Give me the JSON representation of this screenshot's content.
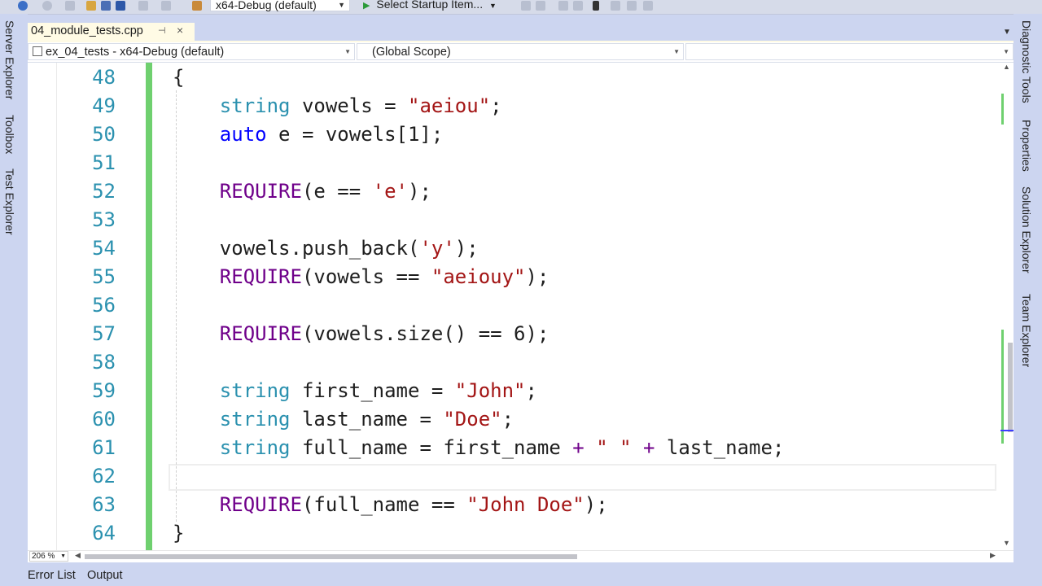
{
  "toolbar": {
    "config_dropdown": "x64-Debug (default)",
    "startup_button": "Select Startup Item..."
  },
  "left_panel": [
    "Server Explorer",
    "Toolbox",
    "Test Explorer"
  ],
  "right_panel": [
    "Diagnostic Tools",
    "Properties",
    "Solution Explorer",
    "Team Explorer"
  ],
  "document_tab": {
    "filename": "04_module_tests.cpp",
    "pin_icon": "pin-icon",
    "close_label": "×"
  },
  "navbar": {
    "project": "ex_04_tests - x64-Debug (default)",
    "scope": "(Global Scope)",
    "member": ""
  },
  "editor": {
    "line_numbers": [
      "48",
      "49",
      "50",
      "51",
      "52",
      "53",
      "54",
      "55",
      "56",
      "57",
      "58",
      "59",
      "60",
      "61",
      "62",
      "63",
      "64"
    ],
    "current_line": "62"
  },
  "status": {
    "zoom": "206 %"
  },
  "bottom_tabs": [
    "Error List",
    "Output"
  ]
}
